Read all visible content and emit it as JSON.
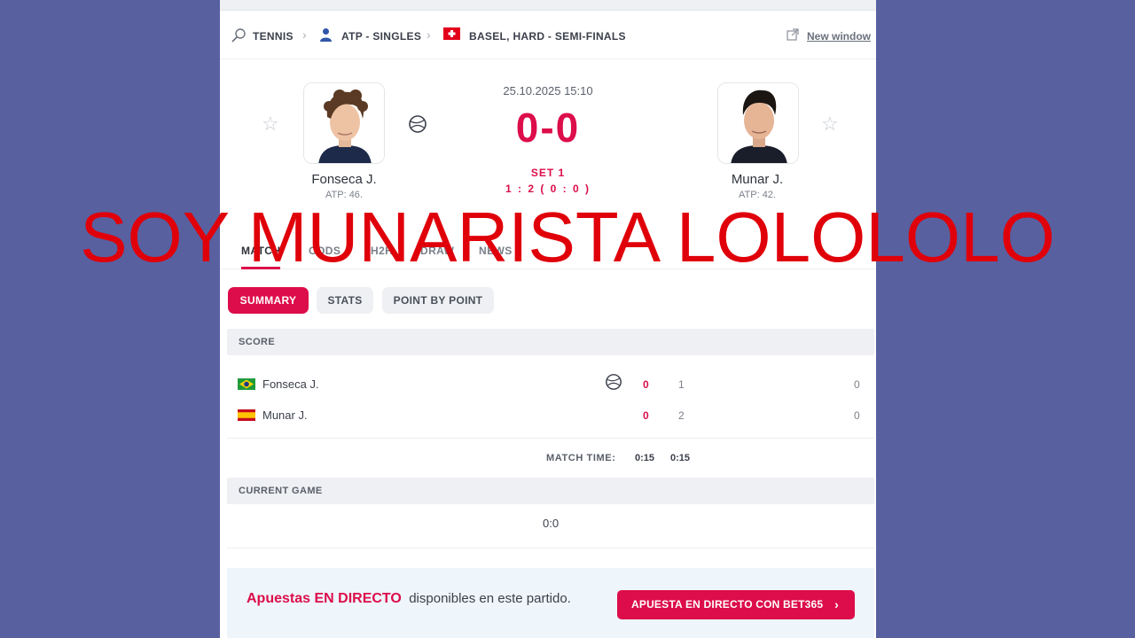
{
  "breadcrumb": {
    "sport": "TENNIS",
    "category": "ATP - SINGLES",
    "tournament": "BASEL, HARD - SEMI-FINALS",
    "new_window": "New window"
  },
  "match": {
    "datetime": "25.10.2025 15:10",
    "score": "0-0",
    "set_label": "SET 1",
    "set_score": "1 : 2 ( 0 : 0 )",
    "home": {
      "name": "Fonseca J.",
      "rank": "ATP: 46."
    },
    "away": {
      "name": "Munar J.",
      "rank": "ATP: 42."
    }
  },
  "tabs": [
    "MATCH",
    "ODDS",
    "H2H",
    "DRAW",
    "NEWS"
  ],
  "subtabs": [
    "SUMMARY",
    "STATS",
    "POINT BY POINT"
  ],
  "score_section": {
    "title": "SCORE",
    "rows": [
      {
        "name": "Fonseca J.",
        "flag": "brazil",
        "game": "0",
        "set1": "1",
        "total": "0",
        "serving": true
      },
      {
        "name": "Munar J.",
        "flag": "spain",
        "game": "0",
        "set1": "2",
        "total": "0",
        "serving": false
      }
    ],
    "match_time_label": "MATCH TIME:",
    "match_time_total": "0:15",
    "match_time_set1": "0:15"
  },
  "current_game": {
    "title": "CURRENT GAME",
    "value": "0:0"
  },
  "promo": {
    "highlight": "Apuestas EN DIRECTO",
    "text": "disponibles en este partido.",
    "button": "APUESTA EN DIRECTO CON BET365"
  },
  "overlay_text": "SOY MUNARISTA LOLOLOLO",
  "colors": {
    "accent": "#dc0d4a",
    "background": "#5860a0",
    "overlay": "#e0000a"
  }
}
